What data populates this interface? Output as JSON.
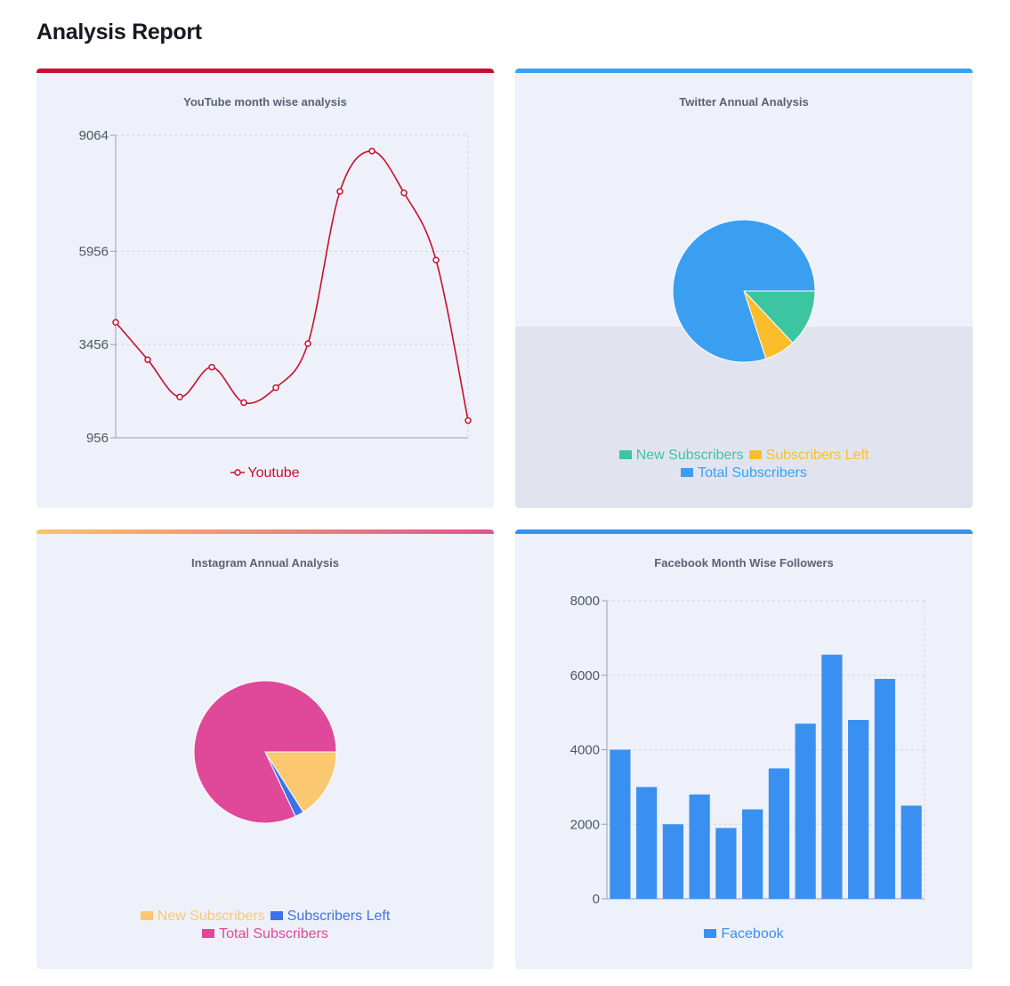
{
  "page": {
    "title": "Analysis Report"
  },
  "charts": {
    "youtube": {
      "title": "YouTube month wise analysis",
      "accent": "#c8102e",
      "chart_data": {
        "type": "line",
        "title": "YouTube month wise analysis",
        "yticks": [
          956,
          3456,
          5956,
          9064
        ],
        "ylim": [
          956,
          9064
        ],
        "grid": true,
        "legend": "bottom",
        "series": [
          {
            "name": "Youtube",
            "color": "#c8102e",
            "values": [
              4050,
              3050,
              2050,
              2850,
              1900,
              2300,
              3480,
              7560,
              8640,
              7520,
              5720,
              1420
            ]
          }
        ]
      }
    },
    "twitter": {
      "title": "Twitter Annual Analysis",
      "accent": "#3a9ff0",
      "chart_data": {
        "type": "pie",
        "title": "Twitter Annual Analysis",
        "legend": "bottom",
        "categories": [
          "New Subscribers",
          "Subscribers Left",
          "Total Subscribers"
        ],
        "values": [
          13,
          7,
          80
        ],
        "colors": [
          "#3cc5a0",
          "#fbbd2c",
          "#3a9ff0"
        ]
      }
    },
    "instagram": {
      "title": "Instagram Annual Analysis",
      "accent": "#e4518f",
      "chart_data": {
        "type": "pie",
        "title": "Instagram Annual Analysis",
        "legend": "bottom",
        "categories": [
          "New Subscribers",
          "Subscribers Left",
          "Total Subscribers"
        ],
        "values": [
          16,
          2,
          82
        ],
        "colors": [
          "#fbc76f",
          "#3a72ec",
          "#e0489a"
        ]
      }
    },
    "facebook": {
      "title": "Facebook Month Wise Followers",
      "accent": "#3a90f0",
      "chart_data": {
        "type": "bar",
        "title": "Facebook Month Wise Followers",
        "yticks": [
          0,
          2000,
          4000,
          6000,
          8000
        ],
        "ylim": [
          0,
          8000
        ],
        "grid": true,
        "legend": "bottom",
        "series": [
          {
            "name": "Facebook",
            "color": "#3a90f0",
            "values": [
              4000,
              3000,
              2000,
              2800,
              1900,
              2400,
              3500,
              4700,
              6550,
              4800,
              5900,
              2500
            ]
          }
        ]
      }
    }
  }
}
